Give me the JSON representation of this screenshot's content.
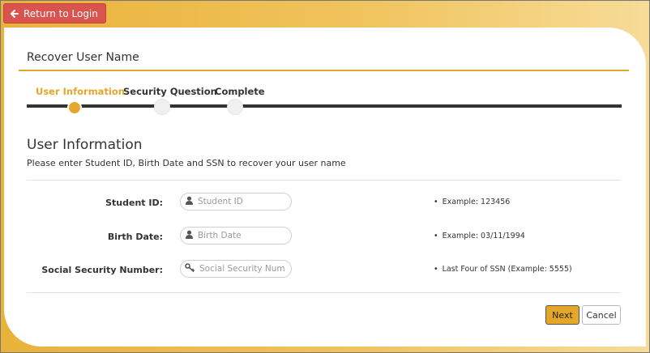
{
  "header": {
    "return_label": "Return to Login"
  },
  "page_title": "Recover User Name",
  "steps": [
    {
      "label": "User Information",
      "state": "active"
    },
    {
      "label": "Security Question",
      "state": "pending"
    },
    {
      "label": "Complete",
      "state": "pending"
    }
  ],
  "section": {
    "title": "User Information",
    "description": "Please enter Student ID, Birth Date and SSN to recover your user name"
  },
  "form": {
    "fields": [
      {
        "label": "Student ID:",
        "placeholder": "Student ID",
        "value": "",
        "icon": "user-icon",
        "hint": "Example: 123456"
      },
      {
        "label": "Birth Date:",
        "placeholder": "Birth Date",
        "value": "",
        "icon": "user-icon",
        "hint": "Example: 03/11/1994"
      },
      {
        "label": "Social Security Number:",
        "placeholder": "Social Security Number",
        "value": "",
        "icon": "key-icon",
        "hint": "Last Four of SSN (Example: 5555)"
      }
    ]
  },
  "actions": {
    "next_label": "Next",
    "cancel_label": "Cancel"
  },
  "colors": {
    "accent": "#e5a72a",
    "danger": "#d9534f",
    "track": "#333333"
  }
}
